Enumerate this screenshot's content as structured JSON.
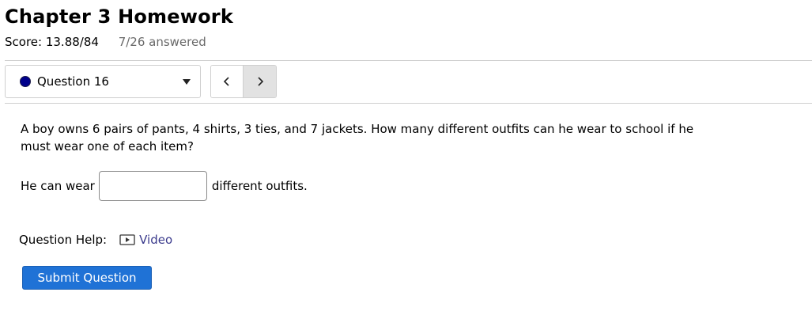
{
  "header": {
    "title": "Chapter 3 Homework",
    "score": "Score: 13.88/84",
    "answered": "7/26 answered"
  },
  "navigation": {
    "question_select": {
      "label": "Question 16",
      "status_color": "#00008b"
    },
    "prev_icon": "chevron-left-icon",
    "next_icon": "chevron-right-icon"
  },
  "question": {
    "text": "A boy owns 6 pairs of pants, 4 shirts, 3 ties, and 7 jackets. How many different outfits can he wear to school if he must wear one of each item?",
    "answer_prefix": "He can wear",
    "answer_value": "",
    "answer_suffix": "different outfits."
  },
  "help": {
    "label": "Question Help:",
    "video_label": "Video",
    "video_icon": "video-play-icon"
  },
  "actions": {
    "submit_label": "Submit Question",
    "submit_color": "#1f72d6"
  }
}
